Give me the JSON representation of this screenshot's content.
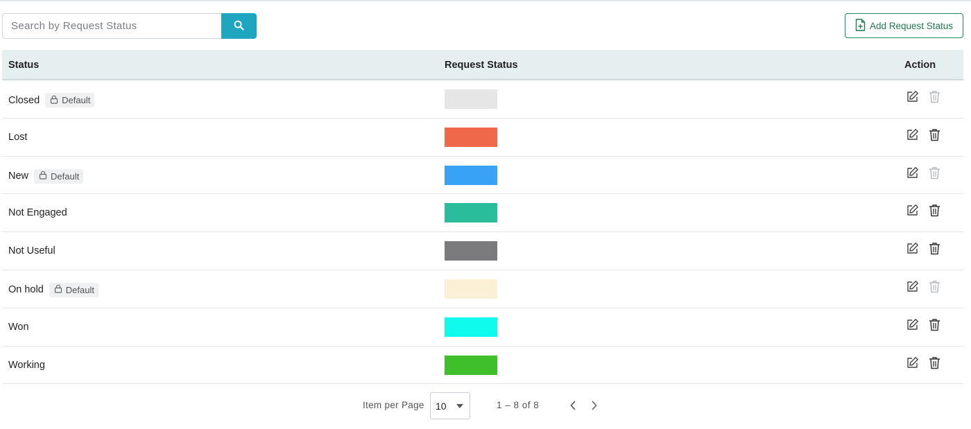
{
  "search": {
    "placeholder": "Search by Request Status",
    "button_icon": "search-icon"
  },
  "add_button": {
    "label": "Add Request Status",
    "icon": "file-plus-icon"
  },
  "table": {
    "headers": {
      "status": "Status",
      "request_status": "Request Status",
      "action": "Action"
    },
    "default_badge_label": "Default",
    "rows": [
      {
        "name": "Closed",
        "default": true,
        "color": "#e6e6e6"
      },
      {
        "name": "Lost",
        "default": false,
        "color": "#f0684a"
      },
      {
        "name": "New",
        "default": true,
        "color": "#38a2f7"
      },
      {
        "name": "Not Engaged",
        "default": false,
        "color": "#29bd9c"
      },
      {
        "name": "Not Useful",
        "default": false,
        "color": "#7b7b7d"
      },
      {
        "name": "On hold",
        "default": true,
        "color": "#fbf0d6"
      },
      {
        "name": "Won",
        "default": false,
        "color": "#0ffbee"
      },
      {
        "name": "Working",
        "default": false,
        "color": "#3fbf2a"
      }
    ]
  },
  "pagination": {
    "items_per_page_label": "Item per Page",
    "items_per_page_value": "10",
    "range_text": "1 – 8 of 8"
  },
  "colors": {
    "accent": "#1ea5bf",
    "add_button": "#1f8a5b",
    "header_bg": "#e6eff0"
  }
}
